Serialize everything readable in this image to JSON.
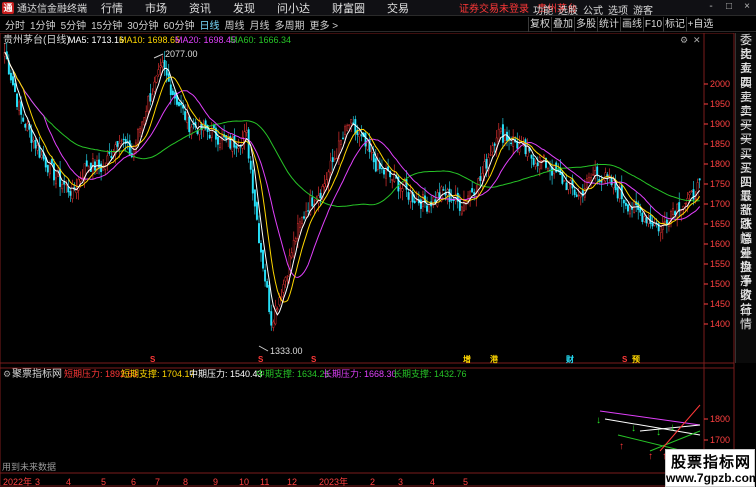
{
  "app": {
    "logo_char": "通",
    "name": "通达信金融终端",
    "menu": [
      "行情",
      "市场",
      "资讯",
      "发现",
      "问小达",
      "财富圈",
      "交易"
    ],
    "notice": "证券交易未登录",
    "stock_name": "贵州茅台",
    "right_menu": [
      "功能",
      "选股",
      "公式",
      "选项",
      "游客"
    ],
    "window_buttons": [
      "-",
      "□",
      "×"
    ]
  },
  "toolbar": {
    "periods": [
      "分时",
      "1分钟",
      "5分钟",
      "15分钟",
      "30分钟",
      "60分钟",
      "日线",
      "周线",
      "月线",
      "多周期",
      "更多 >"
    ],
    "active_period": "日线",
    "buttons": [
      "复权",
      "叠加",
      "多股",
      "统计",
      "画线",
      "F10",
      "标记",
      "+自选"
    ]
  },
  "chart": {
    "header_title": "贵州茅台(日线)",
    "ma_labels": [
      {
        "text": "MA5: 1713.16",
        "color": "#ffffff"
      },
      {
        "text": "MA10: 1698.65",
        "color": "#ffd700"
      },
      {
        "text": "MA20: 1698.45",
        "color": "#e040fb"
      },
      {
        "text": "MA60: 1666.34",
        "color": "#27c427"
      }
    ],
    "price_ticks": [
      "2000",
      "1950",
      "1900",
      "1850",
      "1800",
      "1750",
      "1700",
      "1650",
      "1600",
      "1550",
      "1500",
      "1450",
      "1400"
    ],
    "high_label": "2077.00",
    "low_label": "1333.00",
    "event_marks": [
      "S",
      "S",
      "S",
      "增",
      "港",
      "财",
      "S",
      "预"
    ],
    "ind_title": "聚票指标网",
    "ind_values": [
      {
        "text": "短期压力: 1892.63",
        "color": "#ff3838"
      },
      {
        "text": "短期支撑: 1704.17",
        "color": "#ffd700"
      },
      {
        "text": "中期压力: 1540.43",
        "color": "#ffffff"
      },
      {
        "text": "中期支撑: 1634.21",
        "color": "#27c427"
      },
      {
        "text": "长期压力: 1668.30",
        "color": "#e040fb"
      },
      {
        "text": "长期支撑: 1432.76",
        "color": "#27c427"
      }
    ],
    "ind_ticks": [
      "1800",
      "1700",
      "1600"
    ],
    "ind_footer": "用到未来数据",
    "x_axis": {
      "year_label": "2022年",
      "months": [
        "3",
        "4",
        "5",
        "6",
        "7",
        "8",
        "9",
        "10",
        "11",
        "12",
        "2023年",
        "2",
        "3",
        "4",
        "5"
      ]
    }
  },
  "side_panel": [
    "委比",
    "卖五",
    "卖四",
    "卖三",
    "卖二",
    "卖一",
    "买一",
    "买二",
    "买三",
    "买四",
    "买五",
    "最新",
    "涨跌",
    "涨幅",
    "总量",
    "外盘",
    "换手",
    "净资",
    "收益",
    "行情"
  ],
  "watermark": {
    "title": "股票指标网",
    "url": "www.7gpzb.com"
  },
  "colors": {
    "up": "#ff3838",
    "down": "#27e6ff",
    "ma5": "#ffffff",
    "ma10": "#ffd700",
    "ma20": "#e040fb",
    "ma60": "#27c427"
  }
}
